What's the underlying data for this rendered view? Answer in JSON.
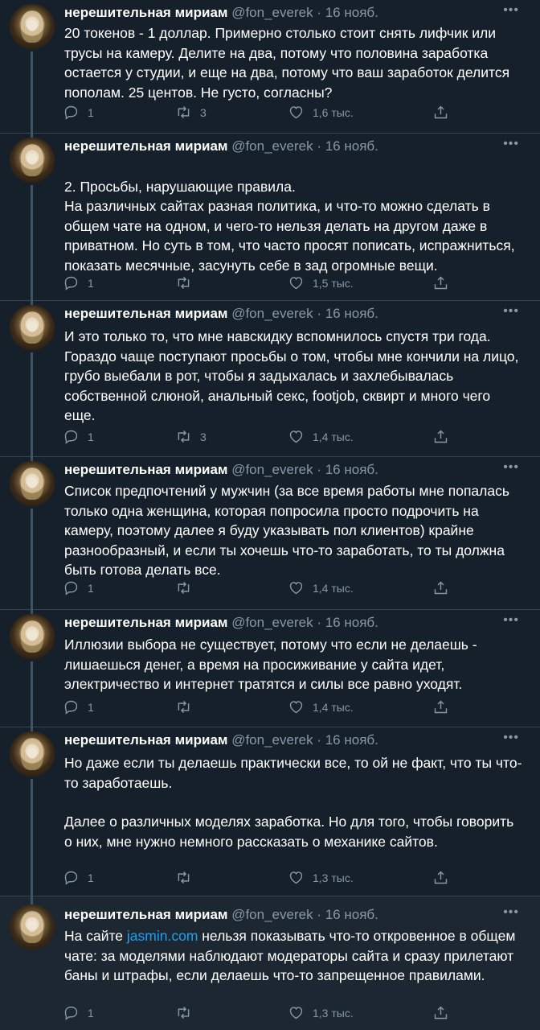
{
  "author": {
    "name": "нерешительная мириам",
    "handle": "@fon_everek",
    "separator": "·",
    "date": "16 нояб."
  },
  "icons": {
    "reply": "reply-icon",
    "retweet": "retweet-icon",
    "like": "like-icon",
    "share": "share-icon",
    "more": "more-icon"
  },
  "colors": {
    "background": "#15202b",
    "divider": "#38444d",
    "muted": "#8899a6",
    "link": "#1da1f2"
  },
  "tweets": [
    {
      "paragraphs": [
        "20 токенов - 1 доллар. Примерно столько стоит снять лифчик или трусы на камеру. Делите на два, потому что половина заработка остается у студии, и еще на два, потому что ваш заработок делится пополам. 25 центов. Не густо, согласны?"
      ],
      "replies": "1",
      "retweets": "3",
      "likes": "1,6 тыс."
    },
    {
      "paragraphs": [
        "2. Просьбы, нарушающие правила.\nНа различных сайтах разная политика, и что-то можно сделать в общем чате на одном, и чего-то нельзя делать на другом даже в приватном. Но суть в том, что часто просят пописать, испражниться, показать месячные, засунуть себе в зад огромные вещи."
      ],
      "replies": "1",
      "retweets": "",
      "likes": "1,5 тыс."
    },
    {
      "paragraphs": [
        "И это только то, что мне навскидку вспомнилось спустя три года. Гораздо чаще поступают просьбы о том, чтобы мне кончили на лицо, грубо выебали в рот, чтобы я задыхалась и захлебывалась собственной слюной, анальный секс, footjob, сквирт и много чего еще."
      ],
      "replies": "1",
      "retweets": "3",
      "likes": "1,4 тыс."
    },
    {
      "paragraphs": [
        "Список предпочтений у мужчин (за все время работы мне попалась только одна женщина, которая попросила просто подрочить на камеру, поэтому далее я буду указывать пол клиентов) крайне разнообразный, и если ты хочешь что-то заработать, то ты должна быть готова делать все."
      ],
      "replies": "1",
      "retweets": "",
      "likes": "1,4 тыс."
    },
    {
      "paragraphs": [
        "Иллюзии выбора не существует, потому что если не делаешь - лишаешься денег, а время на просиживание у сайта идет, электричество и интернет тратятся и силы все равно уходят."
      ],
      "replies": "1",
      "retweets": "",
      "likes": "1,4 тыс."
    },
    {
      "paragraphs": [
        "Но даже если ты делаешь практически все, то ой не факт, что ты что-то заработаешь.",
        "Далее о различных моделях заработка. Но для того, чтобы говорить о них, мне нужно немного рассказать о механике сайтов."
      ],
      "replies": "1",
      "retweets": "",
      "likes": "1,3 тыс."
    },
    {
      "pre": "На сайте ",
      "link": "jasmin.com",
      "post": " нельзя показывать что-то откровенное в общем чате: за моделями наблюдают модераторы сайта и сразу прилетают баны и штрафы, если делаешь что-то запрещенное правилами.",
      "replies": "1",
      "retweets": "",
      "likes": "1,3 тыс."
    }
  ]
}
